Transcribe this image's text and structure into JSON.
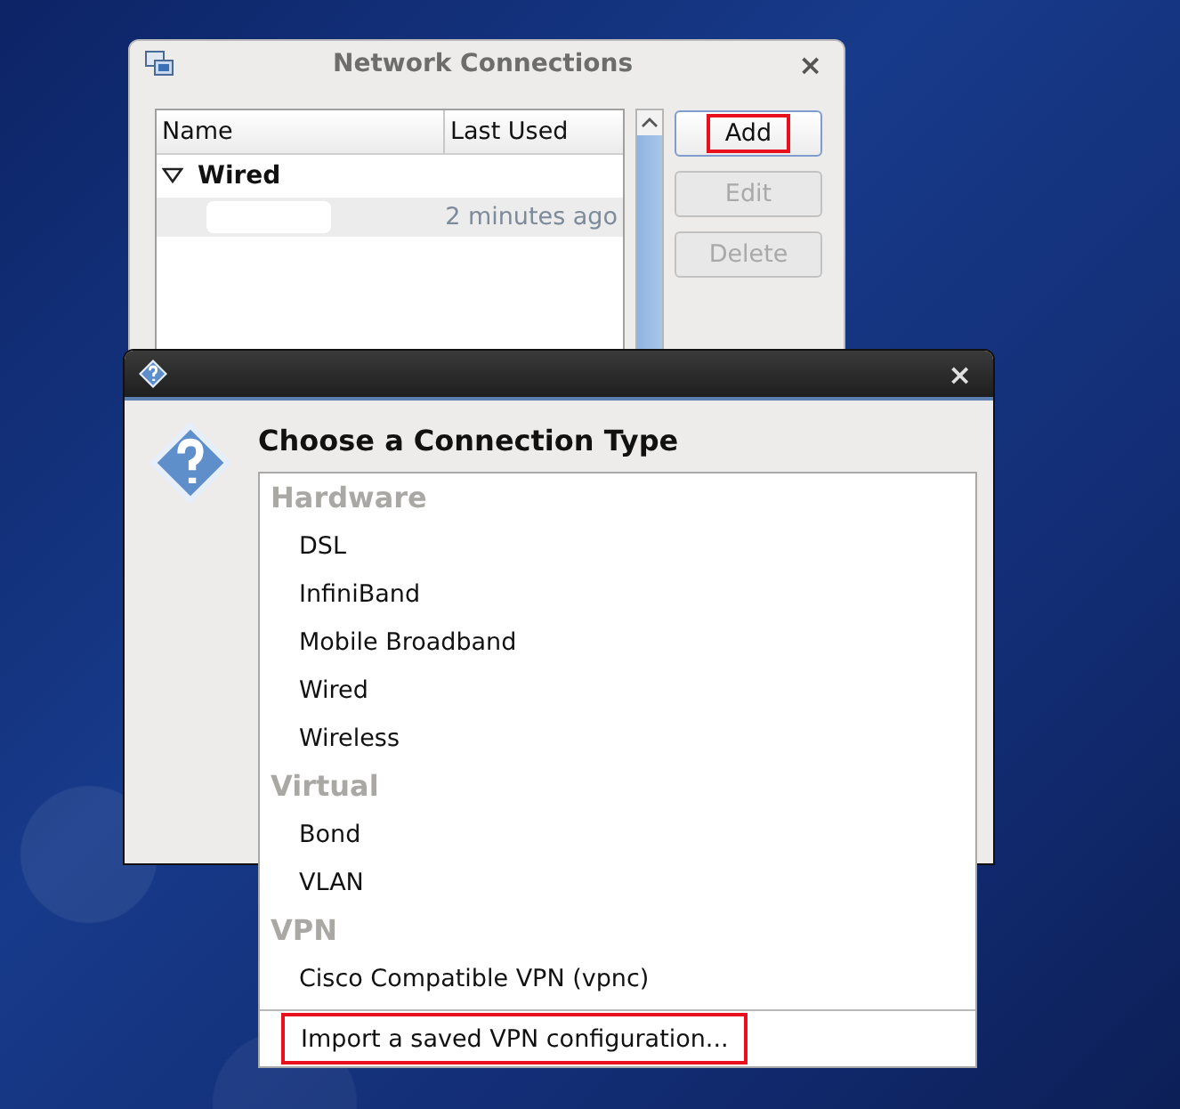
{
  "network_window": {
    "title": "Network Connections",
    "close": "×",
    "columns": [
      "Name",
      "Last Used"
    ],
    "groups": [
      {
        "name": "Wired",
        "expanded": true,
        "connections": [
          {
            "last_used": "2 minutes ago",
            "selected": true
          }
        ]
      }
    ],
    "buttons": [
      {
        "label": "Add",
        "disabled": false,
        "annotated": true
      },
      {
        "label": "Edit",
        "disabled": true,
        "annotated": false
      },
      {
        "label": "Delete",
        "disabled": true,
        "annotated": false
      }
    ]
  },
  "dialog": {
    "close": "×",
    "heading": "Choose a Connection Type",
    "sections": [
      {
        "title": "Hardware",
        "items": [
          "DSL",
          "InfiniBand",
          "Mobile Broadband",
          "Wired",
          "Wireless"
        ]
      },
      {
        "title": "Virtual",
        "items": [
          "Bond",
          "VLAN"
        ]
      },
      {
        "title": "VPN",
        "items": [
          "Cisco Compatible VPN (vpnc)"
        ]
      }
    ],
    "import_item": {
      "label": "Import a saved VPN configuration...",
      "annotated": true
    }
  }
}
